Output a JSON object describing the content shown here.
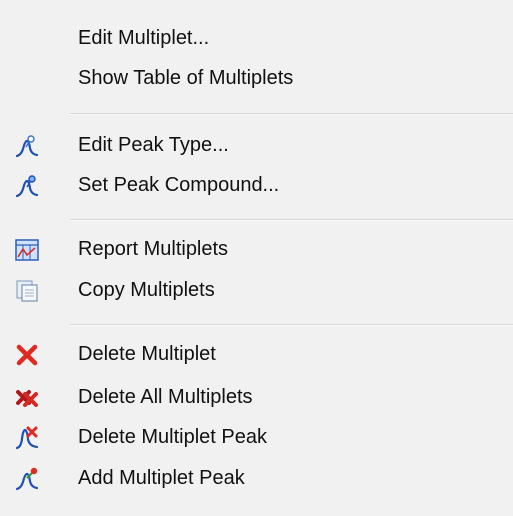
{
  "menu": {
    "items": [
      {
        "label": "Edit Multiplet...",
        "icon": null
      },
      {
        "label": "Show Table of Multiplets",
        "icon": null
      },
      {
        "label": "Edit Peak Type...",
        "icon": "peak-type-icon"
      },
      {
        "label": "Set Peak Compound...",
        "icon": "peak-compound-icon"
      },
      {
        "label": "Report Multiplets",
        "icon": "report-icon"
      },
      {
        "label": "Copy Multiplets",
        "icon": "copy-icon"
      },
      {
        "label": "Delete Multiplet",
        "icon": "delete-x-icon"
      },
      {
        "label": "Delete All Multiplets",
        "icon": "delete-all-icon"
      },
      {
        "label": "Delete Multiplet Peak",
        "icon": "delete-peak-icon"
      },
      {
        "label": "Add Multiplet Peak",
        "icon": "add-peak-icon"
      }
    ]
  }
}
